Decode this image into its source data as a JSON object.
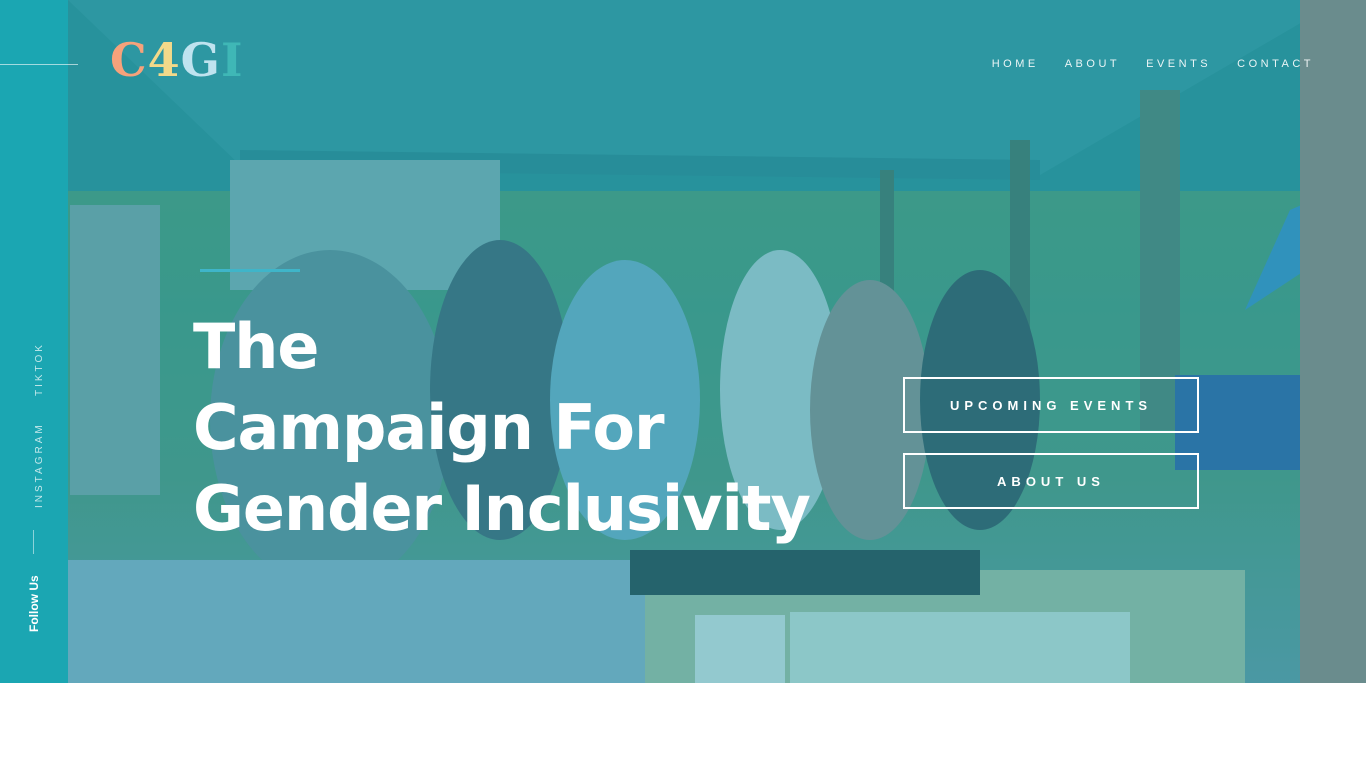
{
  "brand": {
    "logo_letters": [
      {
        "char": "C",
        "color": "#f6a27b"
      },
      {
        "char": "4",
        "color": "#f2d98a"
      },
      {
        "char": "G",
        "color": "#bfe3ef"
      },
      {
        "char": "I",
        "color": "#3fb7b6"
      }
    ]
  },
  "nav": {
    "items": [
      "HOME",
      "ABOUT",
      "EVENTS",
      "CONTACT"
    ]
  },
  "sidebar": {
    "socials": [
      "TIKTOK",
      "INSTAGRAM"
    ],
    "follow_label": "Follow Us"
  },
  "hero": {
    "title_lines": [
      "The",
      "Campaign For",
      "Gender Inclusivity"
    ],
    "buttons": {
      "events": "UPCOMING EVENTS",
      "about": "ABOUT US"
    },
    "overlay_color": "#1e96a5"
  }
}
